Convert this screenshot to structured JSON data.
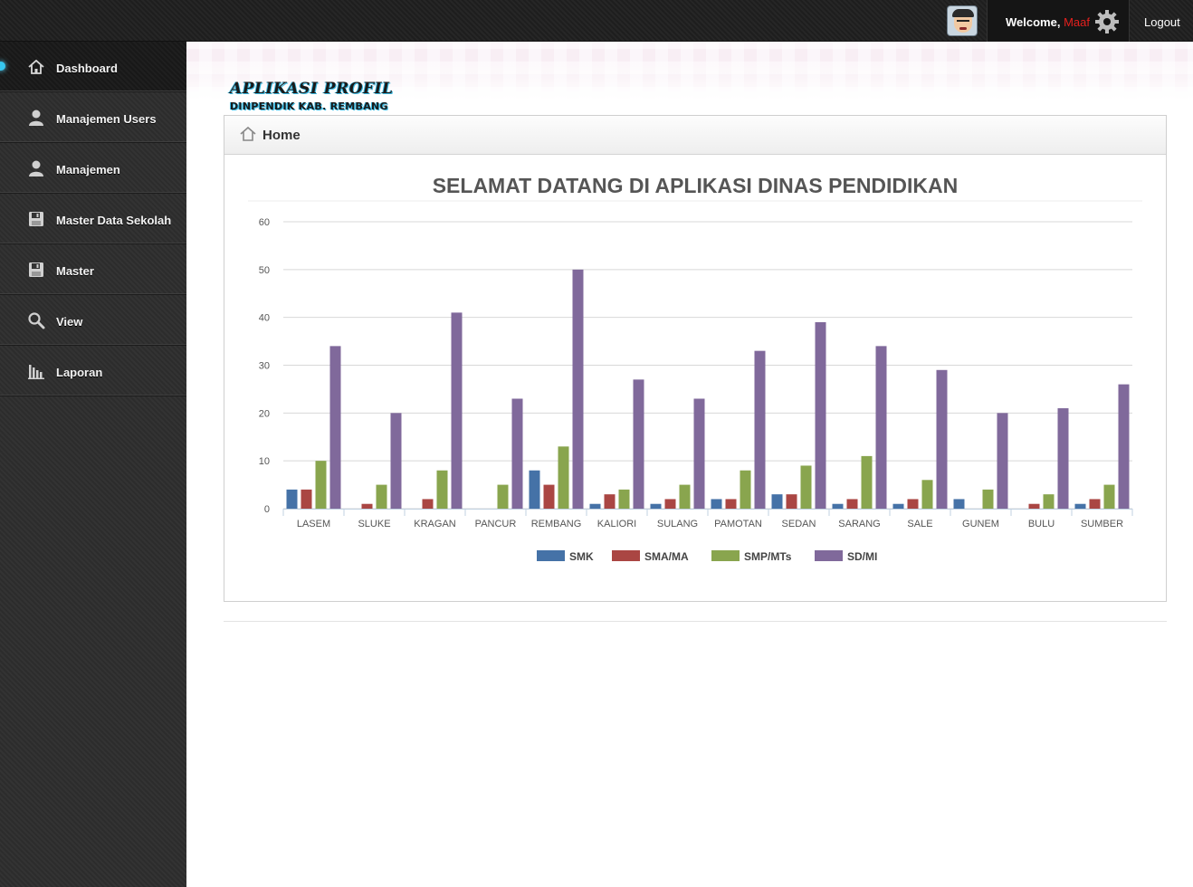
{
  "header": {
    "welcome_label": "Welcome,",
    "username": "Maaf",
    "logout_label": "Logout",
    "avatar_icon": "user-avatar-icon",
    "settings_icon": "gear-icon"
  },
  "sidebar": {
    "items": [
      {
        "label": "Dashboard",
        "icon": "home-icon",
        "active": true
      },
      {
        "label": "Manajemen Users",
        "icon": "user-icon"
      },
      {
        "label": "Manajemen",
        "icon": "user-icon"
      },
      {
        "label": "Master Data Sekolah",
        "icon": "save-icon"
      },
      {
        "label": "Master",
        "icon": "save-icon"
      },
      {
        "label": "View",
        "icon": "search-icon"
      },
      {
        "label": "Laporan",
        "icon": "bar-chart-icon"
      }
    ]
  },
  "logo": {
    "line1": "APLIKASI PROFIL",
    "line2": "DINPENDIK KAB. REMBANG"
  },
  "panel": {
    "title": "Home",
    "icon": "home-icon"
  },
  "colors": {
    "smk": "#4572a7",
    "sma": "#aa4643",
    "smp": "#89a54e",
    "sd": "#80699b",
    "accent": "#37c8f0",
    "username": "#e5201e"
  },
  "chart_data": {
    "type": "bar",
    "title": "SELAMAT DATANG DI APLIKASI DINAS PENDIDIKAN",
    "xlabel": "",
    "ylabel": "",
    "ylim": [
      0,
      60
    ],
    "yticks": [
      0,
      10,
      20,
      30,
      40,
      50,
      60
    ],
    "grid": true,
    "legend_position": "bottom-center",
    "categories": [
      "LASEM",
      "SLUKE",
      "KRAGAN",
      "PANCUR",
      "REMBANG",
      "KALIORI",
      "SULANG",
      "PAMOTAN",
      "SEDAN",
      "SARANG",
      "SALE",
      "GUNEM",
      "BULU",
      "SUMBER"
    ],
    "series": [
      {
        "name": "SMK",
        "color": "#4572a7",
        "values": [
          4,
          0,
          0,
          0,
          8,
          1,
          1,
          2,
          3,
          1,
          1,
          2,
          0,
          1
        ]
      },
      {
        "name": "SMA/MA",
        "color": "#aa4643",
        "values": [
          4,
          1,
          2,
          0,
          5,
          3,
          2,
          2,
          3,
          2,
          2,
          0,
          1,
          2
        ]
      },
      {
        "name": "SMP/MTs",
        "color": "#89a54e",
        "values": [
          10,
          5,
          8,
          5,
          13,
          4,
          5,
          8,
          9,
          11,
          6,
          4,
          3,
          5
        ]
      },
      {
        "name": "SD/MI",
        "color": "#80699b",
        "values": [
          34,
          20,
          41,
          23,
          50,
          27,
          23,
          33,
          39,
          34,
          29,
          20,
          21,
          26
        ]
      }
    ]
  }
}
